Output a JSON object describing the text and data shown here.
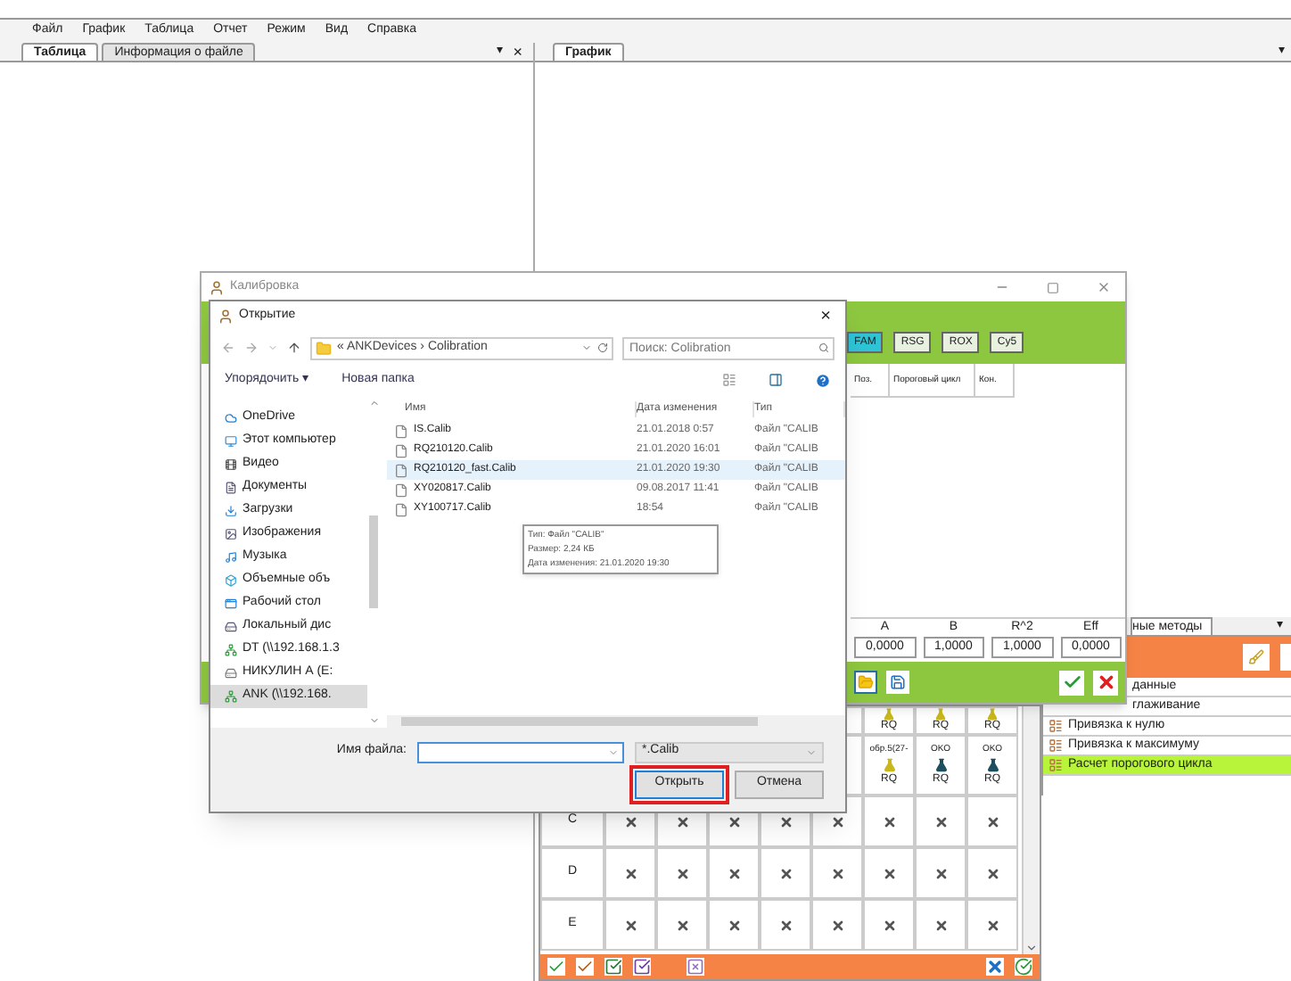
{
  "menu": [
    "Файл",
    "График",
    "Таблица",
    "Отчет",
    "Режим",
    "Вид",
    "Справка"
  ],
  "left_panel": {
    "tabs": [
      {
        "label": "Таблица",
        "selected": true
      },
      {
        "label": "Информация о файле",
        "selected": false
      }
    ],
    "pin": "▾",
    "close": "×"
  },
  "right_panel": {
    "tabs": [
      {
        "label": "График",
        "selected": true
      }
    ],
    "pin": "▾"
  },
  "plate": {
    "top_cells": [
      {
        "flask": {
          "color": "#c9b81c"
        },
        "label": "RQ",
        "sample": "обр.5(27-",
        "sample_flask": {
          "color": "#c9b81c"
        },
        "sample_label": "RQ"
      },
      {
        "flask": {
          "color": "#c9b81c"
        },
        "label": "RQ",
        "sample": "OKO",
        "sample_flask": {
          "color": "#1f4e5f"
        },
        "sample_label": "RQ"
      },
      {
        "flask": {
          "color": "#c9b81c"
        },
        "label": "RQ",
        "sample": "OKO",
        "sample_flask": {
          "color": "#1f4e5f"
        },
        "sample_label": "RQ"
      }
    ],
    "rows": [
      {
        "label": "C",
        "wells": [
          {
            "used": false
          },
          {
            "used": false
          },
          {
            "used": false
          },
          {
            "used": false
          },
          {
            "used": false
          },
          {
            "used": false
          },
          {
            "used": false
          },
          {
            "used": false
          }
        ]
      },
      {
        "label": "D",
        "wells": [
          {
            "used": false
          },
          {
            "used": false
          },
          {
            "used": false
          },
          {
            "used": false
          },
          {
            "used": false
          },
          {
            "used": false
          },
          {
            "used": false
          },
          {
            "used": false
          }
        ]
      },
      {
        "label": "E",
        "wells": [
          {
            "used": false
          },
          {
            "used": false
          },
          {
            "used": false
          },
          {
            "used": false
          },
          {
            "used": false
          },
          {
            "used": false
          },
          {
            "used": false
          },
          {
            "used": false
          }
        ]
      }
    ]
  },
  "methods_panel": {
    "tab": "ные методы",
    "pin": "▾",
    "items": [
      {
        "label": "данные",
        "kind": "partial",
        "selected": false
      },
      {
        "label": "глаживание",
        "kind": "partial",
        "selected": false
      },
      {
        "label": "Привязка к нулю",
        "kind": "step",
        "selected": false
      },
      {
        "label": "Привязка к максимуму",
        "kind": "step",
        "selected": false
      },
      {
        "label": "Расчет порогового цикла",
        "kind": "step",
        "selected": true
      }
    ]
  },
  "calibration": {
    "title": "Калибровка",
    "dyes": [
      {
        "label": "FAM",
        "selected": true
      },
      {
        "label": "RSG",
        "selected": false
      },
      {
        "label": "ROX",
        "selected": false
      },
      {
        "label": "Cy5",
        "selected": false
      }
    ],
    "columns": [
      "Поз.",
      "Пороговый цикл",
      "Кон."
    ],
    "coefficients": [
      {
        "name": "A",
        "value": "0,0000"
      },
      {
        "name": "B",
        "value": "1,0000"
      },
      {
        "name": "R^2",
        "value": "1,0000"
      },
      {
        "name": "Eff",
        "value": "0,0000"
      }
    ]
  },
  "open_dialog": {
    "title": "Открытие",
    "close": "×",
    "path": "« ANKDevices › Colibration",
    "search_placeholder": "Поиск: Colibration",
    "organize": "Упорядочить ▾",
    "new_folder": "Новая папка",
    "sidebar": [
      {
        "label": "OneDrive",
        "kind": "cloud",
        "selected": false
      },
      {
        "label": "Этот компьютер",
        "kind": "pc",
        "selected": false
      },
      {
        "label": "Видео",
        "kind": "video",
        "selected": false
      },
      {
        "label": "Документы",
        "kind": "docs",
        "selected": false
      },
      {
        "label": "Загрузки",
        "kind": "downloads",
        "selected": false
      },
      {
        "label": "Изображения",
        "kind": "images",
        "selected": false
      },
      {
        "label": "Музыка",
        "kind": "music",
        "selected": false
      },
      {
        "label": "Объемные объ",
        "kind": "objects",
        "selected": false
      },
      {
        "label": "Рабочий стол",
        "kind": "desktop",
        "selected": false
      },
      {
        "label": "Локальный дис",
        "kind": "disk",
        "selected": false
      },
      {
        "label": "DT (\\\\192.168.1.3",
        "kind": "network",
        "selected": false
      },
      {
        "label": "НИКУЛИН А (E:",
        "kind": "drive",
        "selected": false
      },
      {
        "label": "ANK (\\\\192.168.",
        "kind": "network",
        "selected": true
      }
    ],
    "columns": [
      "Имя",
      "Дата изменения",
      "Тип"
    ],
    "files": [
      {
        "name": "IS.Calib",
        "date": "21.01.2018 0:57",
        "type": "Файл \"CALIB",
        "selected": false
      },
      {
        "name": "RQ210120.Calib",
        "date": "21.01.2020 16:01",
        "type": "Файл \"CALIB",
        "selected": false
      },
      {
        "name": "RQ210120_fast.Calib",
        "date": "21.01.2020 19:30",
        "type": "Файл \"CALIB",
        "selected": true
      },
      {
        "name": "XY020817.Calib",
        "date": "09.08.2017 11:41",
        "type": "Файл \"CALIB",
        "selected": false
      },
      {
        "name": "XY100717.Calib",
        "date": "18:54",
        "type": "Файл \"CALIB",
        "selected": false
      }
    ],
    "tooltip": [
      "Тип: Файл \"CALIB\"",
      "Размер: 2,24 КБ",
      "Дата изменения: 21.01.2020 19:30"
    ],
    "filename_label": "Имя файла:",
    "filter": "*.Calib",
    "buttons": [
      {
        "label": "Открыть",
        "highlighted": true
      },
      {
        "label": "Отмена",
        "highlighted": false
      }
    ]
  }
}
